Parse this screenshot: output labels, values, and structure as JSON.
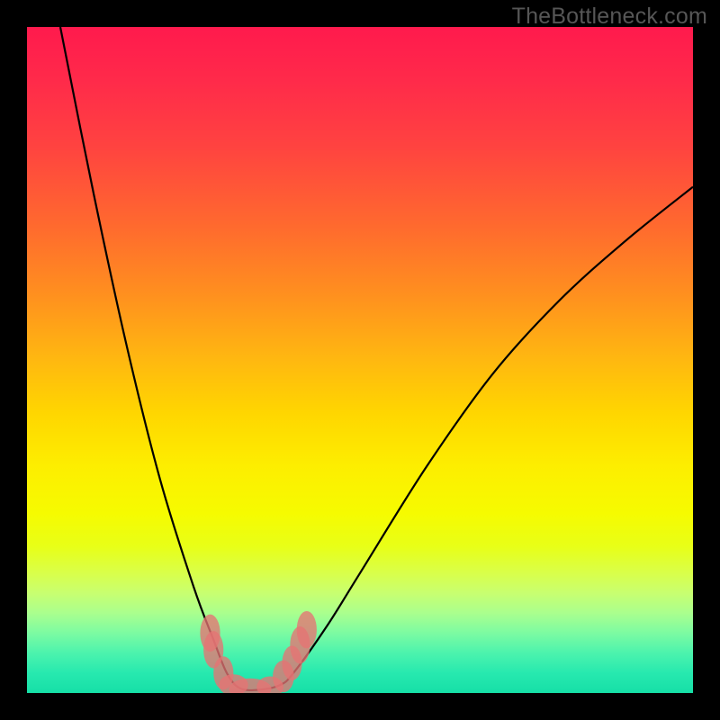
{
  "watermark": "TheBottleneck.com",
  "chart_data": {
    "type": "line",
    "title": "",
    "xlabel": "",
    "ylabel": "",
    "xlim": [
      0,
      100
    ],
    "ylim": [
      0,
      100
    ],
    "series": [
      {
        "name": "bottleneck-curve",
        "description": "V-shaped bottleneck curve; minimum near x≈33, rising steeply on both sides",
        "points": [
          {
            "x": 5,
            "y": 100
          },
          {
            "x": 10,
            "y": 75
          },
          {
            "x": 15,
            "y": 52
          },
          {
            "x": 20,
            "y": 32
          },
          {
            "x": 25,
            "y": 16
          },
          {
            "x": 28,
            "y": 8
          },
          {
            "x": 30,
            "y": 3
          },
          {
            "x": 32,
            "y": 0.7
          },
          {
            "x": 35,
            "y": 0.5
          },
          {
            "x": 38,
            "y": 1.2
          },
          {
            "x": 40,
            "y": 3
          },
          {
            "x": 45,
            "y": 10
          },
          {
            "x": 50,
            "y": 18
          },
          {
            "x": 60,
            "y": 34
          },
          {
            "x": 70,
            "y": 48
          },
          {
            "x": 80,
            "y": 59
          },
          {
            "x": 90,
            "y": 68
          },
          {
            "x": 100,
            "y": 76
          }
        ]
      }
    ],
    "markers": [
      {
        "x": 27.5,
        "y": 9,
        "rx": 1.5,
        "ry": 2.8
      },
      {
        "x": 28.0,
        "y": 6.5,
        "rx": 1.5,
        "ry": 2.8
      },
      {
        "x": 29.5,
        "y": 3.0,
        "rx": 1.5,
        "ry": 2.5
      },
      {
        "x": 31.0,
        "y": 1.2,
        "rx": 2.2,
        "ry": 1.6
      },
      {
        "x": 33.5,
        "y": 0.6,
        "rx": 3.2,
        "ry": 1.6
      },
      {
        "x": 36.5,
        "y": 0.9,
        "rx": 2.0,
        "ry": 1.6
      },
      {
        "x": 38.5,
        "y": 2.5,
        "rx": 1.6,
        "ry": 2.4
      },
      {
        "x": 39.8,
        "y": 4.5,
        "rx": 1.5,
        "ry": 2.6
      },
      {
        "x": 41.0,
        "y": 7.2,
        "rx": 1.5,
        "ry": 2.8
      },
      {
        "x": 42.0,
        "y": 9.5,
        "rx": 1.5,
        "ry": 2.8
      }
    ],
    "colormap": "red-yellow-green vertical gradient (red top, green bottom)"
  }
}
